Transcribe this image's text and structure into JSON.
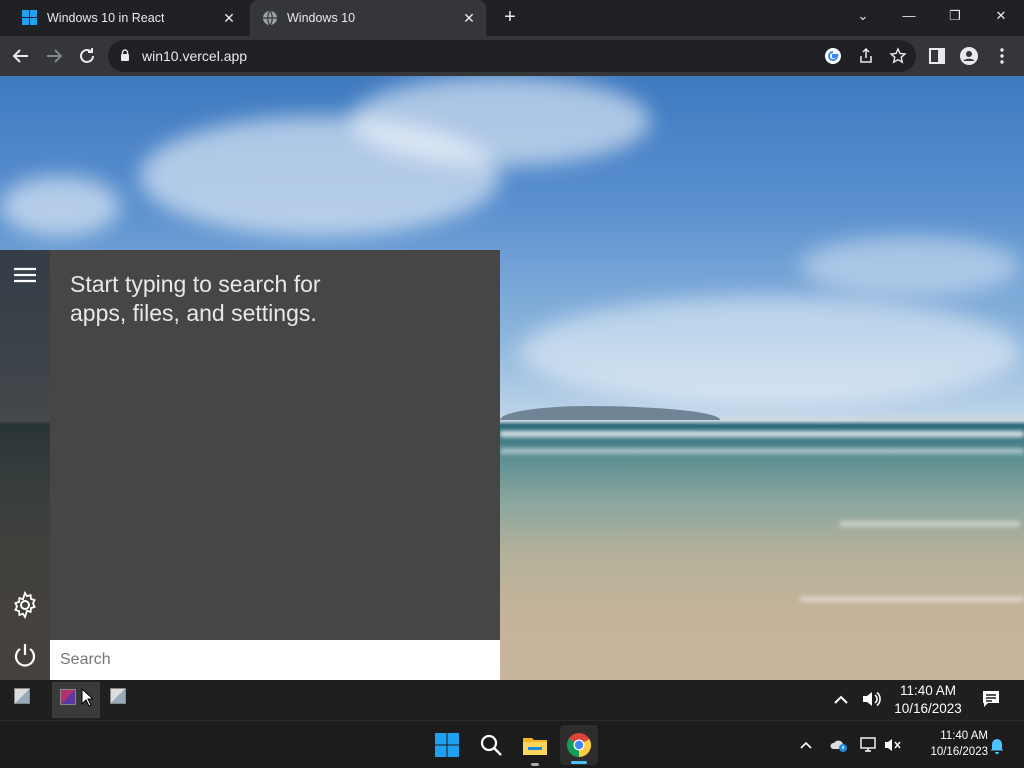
{
  "browser": {
    "tabs": [
      {
        "title": "Windows 10 in React",
        "close": "✕"
      },
      {
        "title": "Windows 10",
        "close": "✕"
      }
    ],
    "new_tab": "+",
    "url": "win10.vercel.app",
    "window_controls": {
      "dropdown": "⌄",
      "minimize": "—",
      "restore": "❐",
      "close": "✕"
    }
  },
  "start_menu": {
    "message": "Start typing to search for apps, files, and settings.",
    "search_placeholder": "Search"
  },
  "react_taskbar": {
    "tray_chevron": "⌃",
    "time": "11:40 AM",
    "date": "10/16/2023"
  },
  "os_taskbar": {
    "time": "11:40 AM",
    "date": "10/16/2023"
  },
  "colors": {
    "chrome_dark": "#202124",
    "chrome_toolbar": "#35363a",
    "start_panel": "#464646",
    "windows_blue": "#1fa0f0",
    "notification_blue": "#4cc2ff"
  }
}
